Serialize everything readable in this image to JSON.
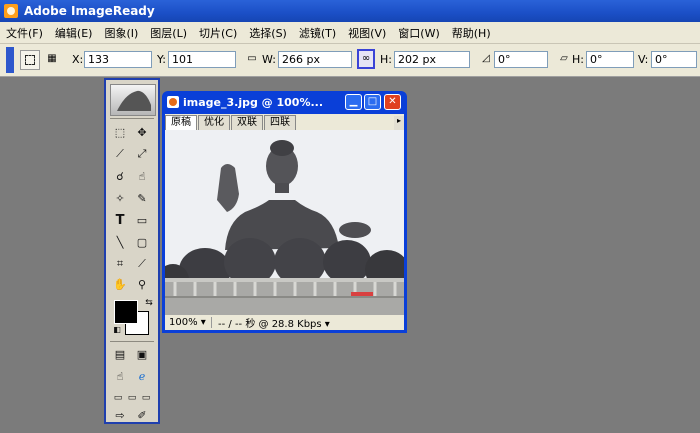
{
  "app": {
    "title": "Adobe ImageReady"
  },
  "menu": [
    "文件(F)",
    "编辑(E)",
    "图象(I)",
    "图层(L)",
    "切片(C)",
    "选择(S)",
    "滤镜(T)",
    "视图(V)",
    "窗口(W)",
    "帮助(H)"
  ],
  "options": {
    "x_label": "X:",
    "x_value": "133",
    "y_label": "Y:",
    "y_value": "101",
    "w_label": "W:",
    "w_value": "266 px",
    "h_label": "H:",
    "h_value": "202 px",
    "angle_value": "0°",
    "skew_h_label": "H:",
    "skew_h_value": "0°",
    "skew_v_label": "V:",
    "skew_v_value": "0°"
  },
  "document": {
    "title": "image_3.jpg @ 100%...",
    "tabs": [
      "原稿",
      "优化",
      "双联",
      "四联"
    ],
    "active_tab": "原稿",
    "zoom": "100%",
    "status": "-- / -- 秒 @ 28.8 Kbps"
  },
  "colors": {
    "accent": "#0a3fd8",
    "foreground": "#000000",
    "background": "#ffffff"
  },
  "icons": [
    "move-icon",
    "marquee-icon",
    "slice-icon",
    "lasso-icon",
    "magic-wand-icon",
    "brush-icon",
    "type-icon",
    "rectangle-icon",
    "line-icon",
    "crop-icon",
    "eyedropper-icon",
    "hand-icon",
    "zoom-icon"
  ]
}
